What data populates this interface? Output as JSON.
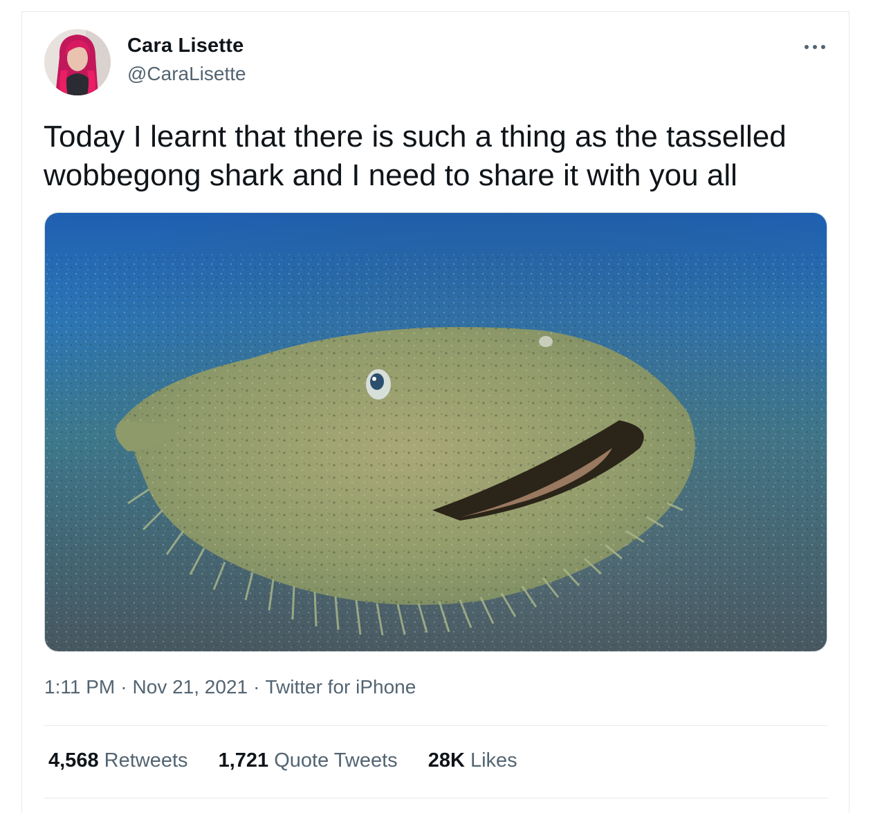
{
  "tweet": {
    "author": {
      "display_name": "Cara Lisette",
      "handle": "@CaraLisette"
    },
    "text": "Today I learnt that there is such a thing as the tasselled wobbegong shark and I need to share it with you all",
    "media": {
      "icon": "photo-tasselled-wobbegong-shark"
    },
    "meta": {
      "time": "1:11 PM",
      "date": "Nov 21, 2021",
      "source": "Twitter for iPhone",
      "separator": "·"
    },
    "stats": {
      "retweets_count": "4,568",
      "retweets_label": "Retweets",
      "quotes_count": "1,721",
      "quotes_label": "Quote Tweets",
      "likes_count": "28K",
      "likes_label": "Likes"
    }
  },
  "icons": {
    "more": "more-options-icon"
  },
  "colors": {
    "text_primary": "#0f1419",
    "text_secondary": "#536471",
    "border": "#e6e9ec",
    "avatar_hair": "#d6336c"
  }
}
